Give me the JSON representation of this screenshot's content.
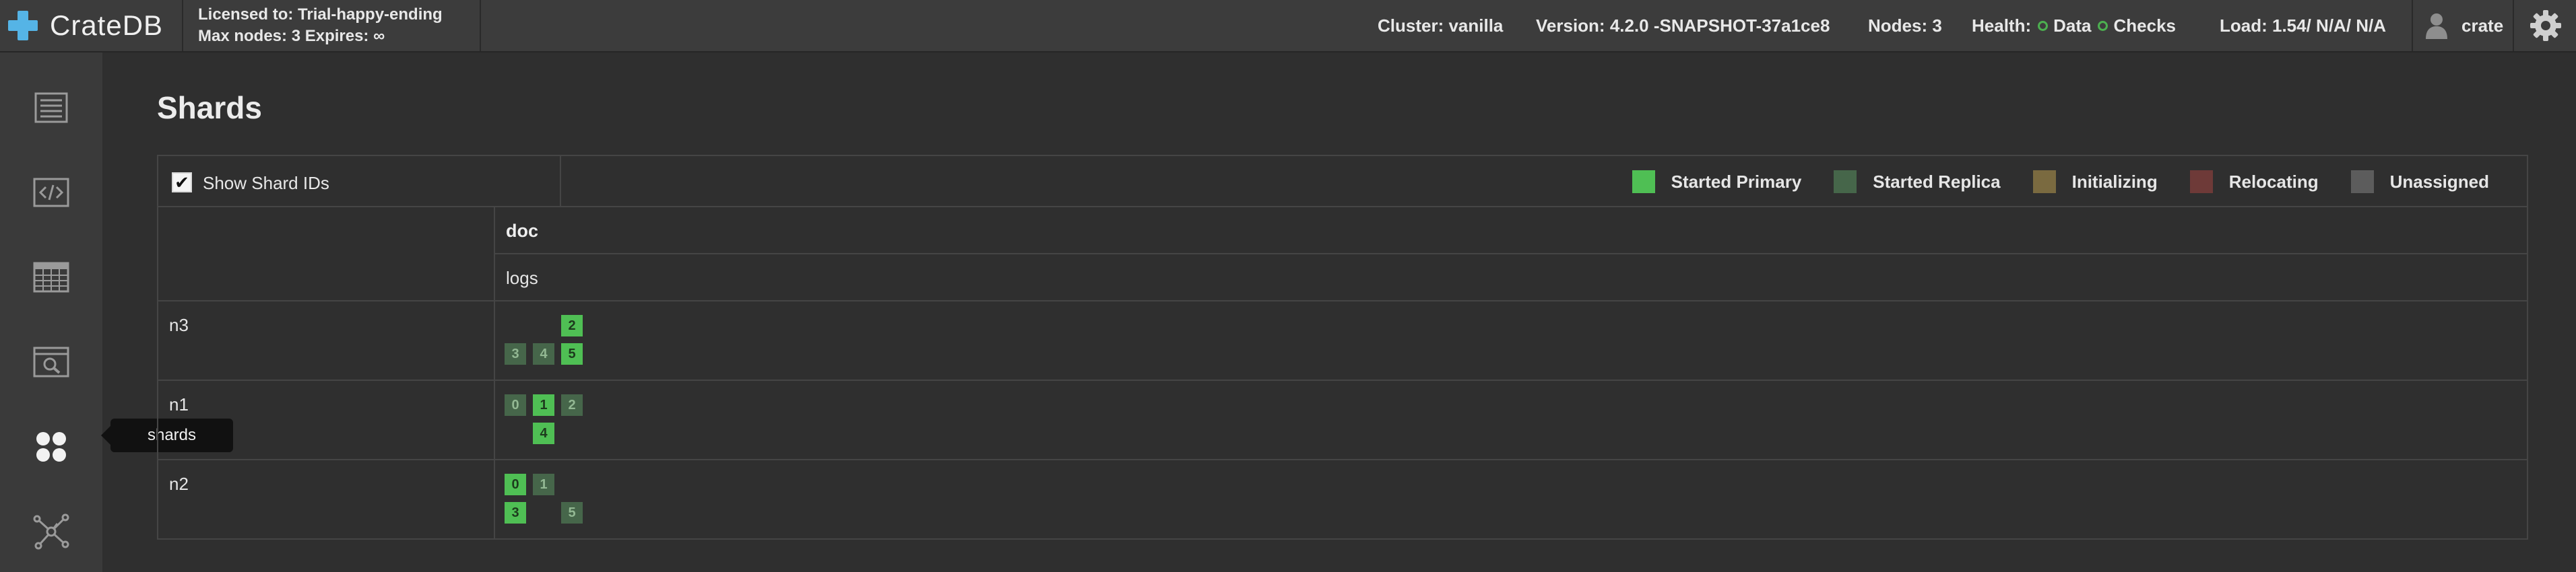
{
  "app": {
    "name": "CrateDB"
  },
  "license": {
    "line1": "Licensed to: Trial-happy-ending",
    "line2": "Max nodes: 3 Expires: ∞"
  },
  "status": {
    "cluster": "Cluster: vanilla",
    "version": "Version: 4.2.0 -SNAPSHOT-37a1ce8",
    "nodes": "Nodes: 3",
    "health_label": "Health:",
    "health_data": "Data",
    "health_checks": "Checks",
    "load": "Load: 1.54/ N/A/ N/A"
  },
  "user": {
    "name": "crate"
  },
  "icons": {
    "brand": "cratedb-plus-logo",
    "user": "user-icon",
    "settings": "gear-icon",
    "nav": [
      "overview-icon",
      "console-icon",
      "tables-icon",
      "views-icon",
      "shards-icon",
      "cluster-icon"
    ]
  },
  "tooltip": {
    "text": "shards"
  },
  "page": {
    "title": "Shards"
  },
  "controls": {
    "show_shard_ids_label": "Show Shard IDs",
    "show_shard_ids_checked": true,
    "check_glyph": "✔"
  },
  "legend": [
    {
      "label": "Started Primary",
      "color": "#4fbf54"
    },
    {
      "label": "Started Replica",
      "color": "#46664a"
    },
    {
      "label": "Initializing",
      "color": "#7a6a40"
    },
    {
      "label": "Relocating",
      "color": "#6e3a38"
    },
    {
      "label": "Unassigned",
      "color": "#5c5c5c"
    }
  ],
  "schema": {
    "name": "doc"
  },
  "table": {
    "name": "logs"
  },
  "nodes": [
    {
      "name": "n3",
      "rows": [
        [
          null,
          null,
          {
            "id": "2",
            "state": "primary"
          }
        ],
        [
          {
            "id": "3",
            "state": "replica"
          },
          {
            "id": "4",
            "state": "replica"
          },
          {
            "id": "5",
            "state": "primary"
          }
        ]
      ]
    },
    {
      "name": "n1",
      "rows": [
        [
          {
            "id": "0",
            "state": "replica"
          },
          {
            "id": "1",
            "state": "primary"
          },
          {
            "id": "2",
            "state": "replica"
          }
        ],
        [
          null,
          {
            "id": "4",
            "state": "primary"
          },
          null
        ]
      ]
    },
    {
      "name": "n2",
      "rows": [
        [
          {
            "id": "0",
            "state": "primary"
          },
          {
            "id": "1",
            "state": "replica"
          },
          null
        ],
        [
          {
            "id": "3",
            "state": "primary"
          },
          null,
          {
            "id": "5",
            "state": "replica"
          }
        ]
      ]
    }
  ]
}
